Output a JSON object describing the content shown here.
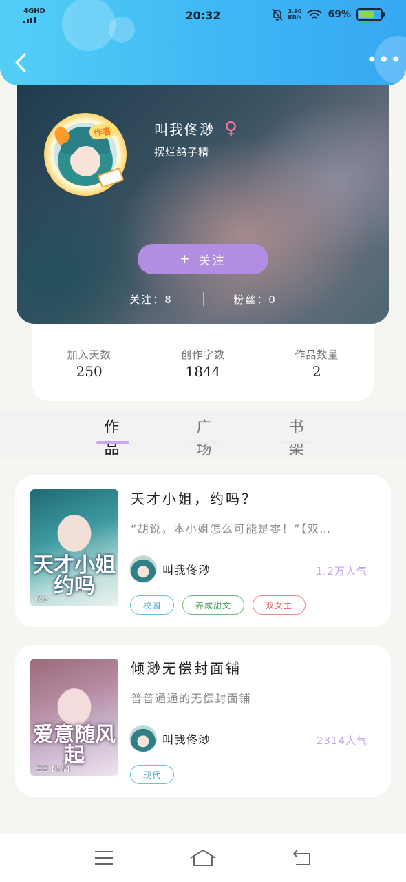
{
  "status_bar": {
    "network": "4GHD",
    "time": "20:32",
    "speed_value": "3.90",
    "speed_unit": "KB/s",
    "battery_percent": "69%",
    "battery_level": 0.69,
    "battery_color": "#8ed64d"
  },
  "header": {
    "back_icon": "chevron-left-icon",
    "more_icon": "more-dots-icon",
    "more_glyph": "•••",
    "accent_color": "#3fb7f4"
  },
  "profile": {
    "badge": "作者",
    "username": "叫我佟渺",
    "gender_symbol": "♀",
    "signature": "摆烂鸽子精",
    "follow_button_plus": "+",
    "follow_button_label": "关注",
    "following_text": "关注：8",
    "followers_text": "粉丝：0"
  },
  "stats": [
    {
      "label": "加入天数",
      "value": "250"
    },
    {
      "label": "创作字数",
      "value": "1844"
    },
    {
      "label": "作品数量",
      "value": "2"
    }
  ],
  "tabs": [
    {
      "label": "作品",
      "active": true
    },
    {
      "label": "广场",
      "active": false
    },
    {
      "label": "书架",
      "active": false
    }
  ],
  "works": [
    {
      "title": "天才小姐，约吗？",
      "description": "“胡说，本小姐怎么可能是零！”【双…",
      "cover_title": "天才小姐约吗",
      "cover_subtitle": "佟渺",
      "author": "叫我佟渺",
      "popularity": "1.2万人气",
      "tags": [
        {
          "label": "校园",
          "color": "blue"
        },
        {
          "label": "养成甜文",
          "color": "green"
        },
        {
          "label": "双女主",
          "color": "red"
        }
      ]
    },
    {
      "title": "倾渺无偿封面铺",
      "description": "普普通通的无偿封面铺",
      "cover_title": "爱意随风起",
      "cover_subtitle": "里里【作品】",
      "author": "叫我佟渺",
      "popularity": "2314人气",
      "tags": [
        {
          "label": "现代",
          "color": "blue"
        }
      ]
    }
  ],
  "system_nav": {
    "menu_icon": "menu-icon",
    "home_icon": "home-icon",
    "back_icon": "back-arrow-icon"
  }
}
